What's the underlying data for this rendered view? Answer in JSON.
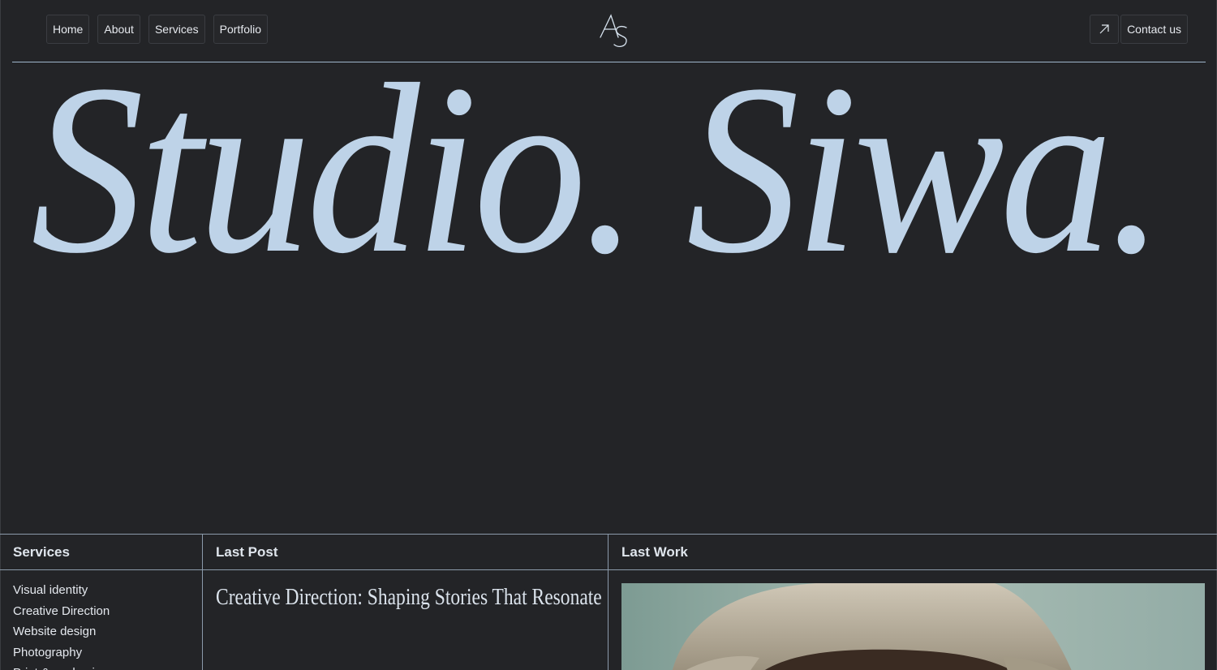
{
  "nav": {
    "items": [
      {
        "label": "Home"
      },
      {
        "label": "About"
      },
      {
        "label": "Services"
      },
      {
        "label": "Portfolio"
      }
    ],
    "logo_text": "AS",
    "contact_label": "Contact us",
    "contact_icon": "arrow-up-right-icon"
  },
  "hero": {
    "title": "Studio. Siwa."
  },
  "sections": {
    "services": {
      "heading": "Services",
      "items": [
        "Visual identity",
        "Creative Direction",
        "Website design",
        "Photography",
        "Print & packaging"
      ]
    },
    "last_post": {
      "heading": "Last Post",
      "title": "Creative Direction: Shaping Stories That Resonate"
    },
    "last_work": {
      "heading": "Last Work",
      "image_desc": "portrait of person wearing bucket hat"
    }
  },
  "colors": {
    "background": "#232427",
    "accent": "#bed3e8",
    "rule": "#9fb6cc",
    "border": "#3b3d42"
  }
}
